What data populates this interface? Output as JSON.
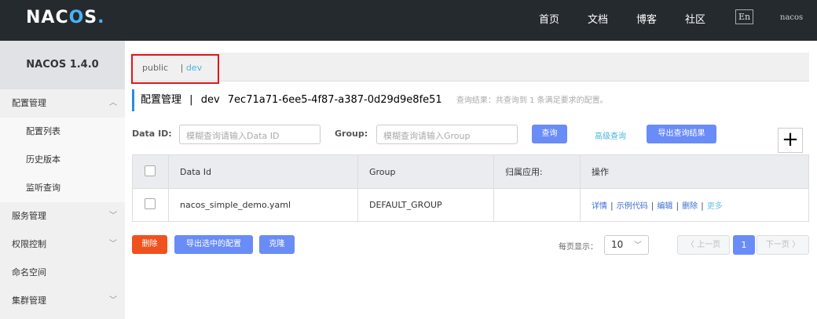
{
  "header": {
    "logo": "NACOS.",
    "nav": [
      "首页",
      "文档",
      "博客",
      "社区"
    ],
    "lang": "En",
    "user": "nacos"
  },
  "sidebar": {
    "version": "NACOS 1.4.0",
    "items": [
      {
        "label": "配置管理",
        "chevron": "^"
      },
      {
        "label": "配置列表"
      },
      {
        "label": "历史版本"
      },
      {
        "label": "监听查询"
      },
      {
        "label": "服务管理",
        "chevron": "v"
      },
      {
        "label": "权限控制",
        "chevron": "v"
      },
      {
        "label": "命名空间"
      },
      {
        "label": "集群管理",
        "chevron": "v"
      }
    ]
  },
  "namespaces": {
    "public": "public",
    "sep": "|",
    "dev": "dev"
  },
  "title": {
    "main": "配置管理",
    "sep": "|",
    "ns": "dev",
    "id": "7ec71a71-6ee5-4f87-a387-0d29d9e8fe51",
    "result": "查询结果：共查询到 1 条满足要求的配置。"
  },
  "filters": {
    "dataid_label": "Data ID:",
    "dataid_placeholder": "模糊查询请输入Data ID",
    "group_label": "Group:",
    "group_placeholder": "模糊查询请输入Group",
    "search": "查询",
    "advanced": "高级查询",
    "export": "导出查询结果",
    "add": "+"
  },
  "table": {
    "headers": [
      "Data Id",
      "Group",
      "归属应用:",
      "操作"
    ],
    "rows": [
      {
        "dataId": "nacos_simple_demo.yaml",
        "group": "DEFAULT_GROUP",
        "app": "",
        "ops": [
          "详情",
          "示例代码",
          "编辑",
          "删除",
          "更多"
        ]
      }
    ]
  },
  "footer": {
    "delete": "删除",
    "export_selected": "导出选中的配置",
    "clone": "克隆",
    "per_page_label": "每页显示：",
    "per_page": "10",
    "prev": "〈 上一页",
    "page": "1",
    "next": "下一页 〉"
  }
}
